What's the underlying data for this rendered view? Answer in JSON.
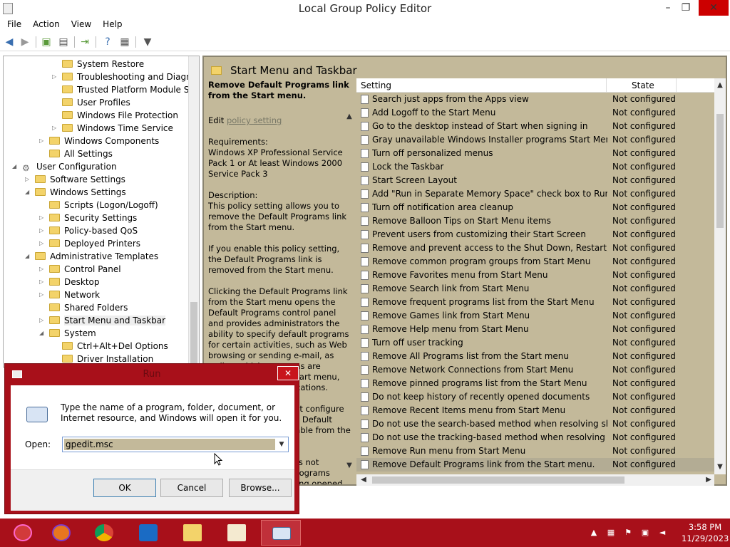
{
  "window": {
    "title": "Local Group Policy Editor",
    "minimize": "–",
    "maximize": "❐",
    "close": "✕"
  },
  "menu": [
    "File",
    "Action",
    "View",
    "Help"
  ],
  "tree": [
    {
      "label": "System Restore",
      "level": 3,
      "arrow": ""
    },
    {
      "label": "Troubleshooting and Diagnos",
      "level": 3,
      "arrow": "▷"
    },
    {
      "label": "Trusted Platform Module Serv",
      "level": 3,
      "arrow": ""
    },
    {
      "label": "User Profiles",
      "level": 3,
      "arrow": ""
    },
    {
      "label": "Windows File Protection",
      "level": 3,
      "arrow": ""
    },
    {
      "label": "Windows Time Service",
      "level": 3,
      "arrow": "▷"
    },
    {
      "label": "Windows Components",
      "level": 2,
      "arrow": "▷"
    },
    {
      "label": "All Settings",
      "level": 2,
      "arrow": ""
    },
    {
      "label": "User Configuration",
      "level": 0,
      "arrow": "◢"
    },
    {
      "label": "Software Settings",
      "level": 1,
      "arrow": "▷"
    },
    {
      "label": "Windows Settings",
      "level": 1,
      "arrow": "◢"
    },
    {
      "label": "Scripts (Logon/Logoff)",
      "level": 2,
      "arrow": ""
    },
    {
      "label": "Security Settings",
      "level": 2,
      "arrow": "▷"
    },
    {
      "label": "Policy-based QoS",
      "level": 2,
      "arrow": "▷"
    },
    {
      "label": "Deployed Printers",
      "level": 2,
      "arrow": "▷"
    },
    {
      "label": "Administrative Templates",
      "level": 1,
      "arrow": "◢"
    },
    {
      "label": "Control Panel",
      "level": 2,
      "arrow": "▷"
    },
    {
      "label": "Desktop",
      "level": 2,
      "arrow": "▷"
    },
    {
      "label": "Network",
      "level": 2,
      "arrow": "▷"
    },
    {
      "label": "Shared Folders",
      "level": 2,
      "arrow": ""
    },
    {
      "label": "Start Menu and Taskbar",
      "level": 2,
      "arrow": "▷",
      "selected": true
    },
    {
      "label": "System",
      "level": 2,
      "arrow": "◢"
    },
    {
      "label": "Ctrl+Alt+Del Options",
      "level": 3,
      "arrow": ""
    },
    {
      "label": "Driver Installation",
      "level": 3,
      "arrow": ""
    }
  ],
  "right_pane": {
    "header": "Start Menu and Taskbar",
    "description": {
      "title": "Remove Default Programs link from the Start menu.",
      "edit_prefix": "Edit",
      "edit_link": "policy setting",
      "paragraphs": [
        "Requirements:\nWindows XP Professional Service Pack 1 or At least Windows 2000 Service Pack 3",
        "Description:\nThis policy setting allows you to remove the Default Programs link from the Start menu.",
        "If you enable this policy setting, the Default Programs link is removed from the Start menu.",
        "Clicking the Default Programs link from the Start menu opens the Default Programs control panel and provides administrators the ability to specify default programs for certain activities, such as Web browsing or sending e-mail, as well as which programs are accessible from the Start menu, desktop, and other locations.",
        "If you disable or do not configure this policy setting, the Default Programs link is available from the Start menu.",
        "Note: This setting does not prevent the Default Programs control panel from being opened."
      ]
    },
    "columns": {
      "setting": "Setting",
      "state": "State"
    },
    "settings": [
      {
        "name": "Search just apps from the Apps view",
        "state": "Not configured"
      },
      {
        "name": "Add Logoff to the Start Menu",
        "state": "Not configured"
      },
      {
        "name": "Go to the desktop instead of Start when signing in",
        "state": "Not configured"
      },
      {
        "name": "Gray unavailable Windows Installer programs Start Menu sh...",
        "state": "Not configured"
      },
      {
        "name": "Turn off personalized menus",
        "state": "Not configured"
      },
      {
        "name": "Lock the Taskbar",
        "state": "Not configured"
      },
      {
        "name": "Start Screen Layout",
        "state": "Not configured"
      },
      {
        "name": "Add \"Run in Separate Memory Space\" check box to Run dial...",
        "state": "Not configured"
      },
      {
        "name": "Turn off notification area cleanup",
        "state": "Not configured"
      },
      {
        "name": "Remove Balloon Tips on Start Menu items",
        "state": "Not configured"
      },
      {
        "name": "Prevent users from customizing their Start Screen",
        "state": "Not configured"
      },
      {
        "name": "Remove and prevent access to the Shut Down, Restart, Sleep...",
        "state": "Not configured"
      },
      {
        "name": "Remove common program groups from Start Menu",
        "state": "Not configured"
      },
      {
        "name": "Remove Favorites menu from Start Menu",
        "state": "Not configured"
      },
      {
        "name": "Remove Search link from Start Menu",
        "state": "Not configured"
      },
      {
        "name": "Remove frequent programs list from the Start Menu",
        "state": "Not configured"
      },
      {
        "name": "Remove Games link from Start Menu",
        "state": "Not configured"
      },
      {
        "name": "Remove Help menu from Start Menu",
        "state": "Not configured"
      },
      {
        "name": "Turn off user tracking",
        "state": "Not configured"
      },
      {
        "name": "Remove All Programs list from the Start menu",
        "state": "Not configured"
      },
      {
        "name": "Remove Network Connections from Start Menu",
        "state": "Not configured"
      },
      {
        "name": "Remove pinned programs list from the Start Menu",
        "state": "Not configured"
      },
      {
        "name": "Do not keep history of recently opened documents",
        "state": "Not configured"
      },
      {
        "name": "Remove Recent Items menu from Start Menu",
        "state": "Not configured"
      },
      {
        "name": "Do not use the search-based method when resolving shell s...",
        "state": "Not configured"
      },
      {
        "name": "Do not use the tracking-based method when resolving shell ...",
        "state": "Not configured"
      },
      {
        "name": "Remove Run menu from Start Menu",
        "state": "Not configured"
      },
      {
        "name": "Remove Default Programs link from the Start menu.",
        "state": "Not configured",
        "selected": true
      }
    ]
  },
  "run_dialog": {
    "title": "Run",
    "close": "✕",
    "message": "Type the name of a program, folder, document, or Internet resource, and Windows will open it for you.",
    "open_label": "Open:",
    "open_value": "gpedit.msc",
    "ok": "OK",
    "cancel": "Cancel",
    "browse": "Browse..."
  },
  "taskbar": {
    "apps": [
      "start-orb",
      "firefox",
      "chrome",
      "outlook",
      "file-explorer",
      "notepad",
      "run"
    ],
    "time": "3:58 PM",
    "date": "11/29/2023"
  },
  "colors": {
    "accent": "#a8101a",
    "pane_bg": "#c3b99a",
    "selection": "#b3ac94"
  }
}
